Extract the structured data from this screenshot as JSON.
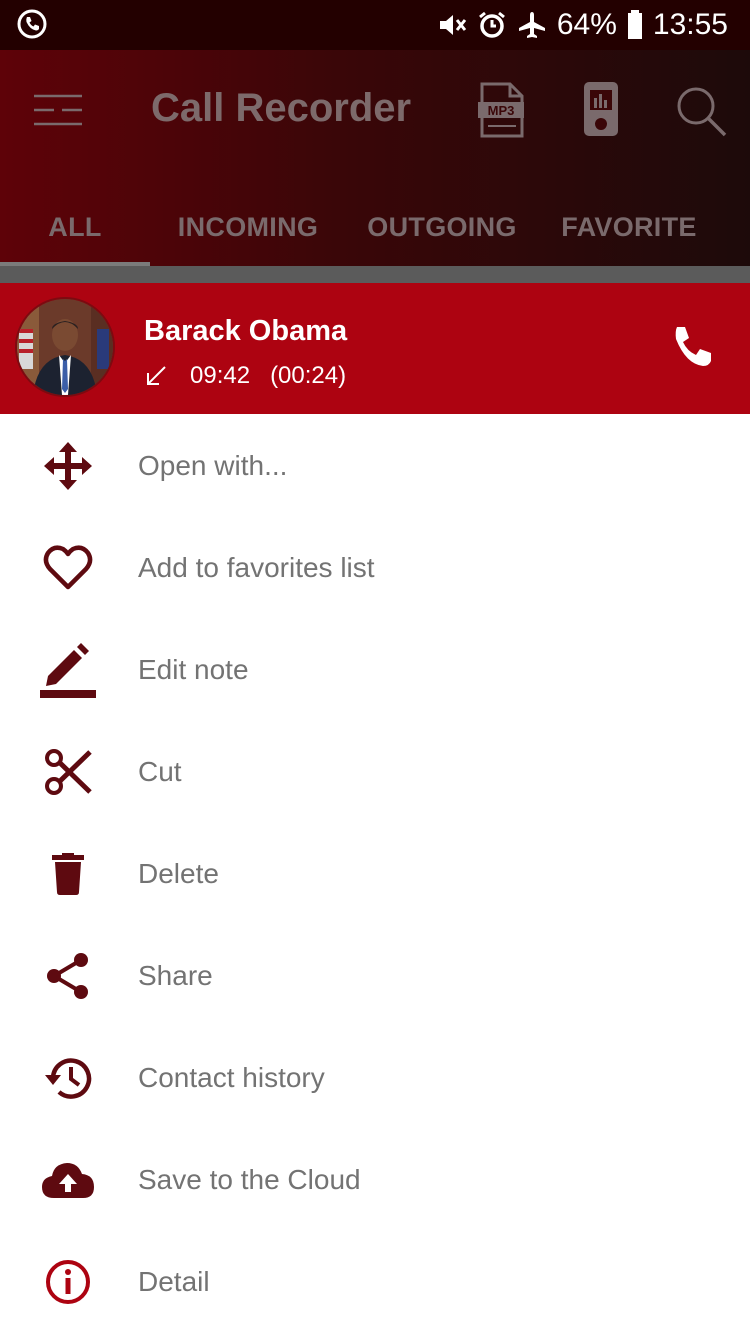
{
  "status_bar": {
    "battery": "64%",
    "time": "13:55",
    "icons": [
      "phone-icon",
      "mute-icon",
      "alarm-icon",
      "airplane-icon",
      "battery-icon"
    ]
  },
  "app_bar": {
    "title": "Call Recorder",
    "actions": [
      "menu-icon",
      "mp3-icon",
      "recorder-device-icon",
      "search-icon"
    ]
  },
  "tabs": [
    {
      "label": "ALL",
      "selected": true
    },
    {
      "label": "INCOMING",
      "selected": false
    },
    {
      "label": "OUTGOING",
      "selected": false
    },
    {
      "label": "FAVORITE",
      "selected": false
    }
  ],
  "contact": {
    "name": "Barack Obama",
    "time": "09:42",
    "duration": "(00:24)",
    "direction_icon": "incoming-arrow-icon"
  },
  "menu": [
    {
      "label": "Open with...",
      "icon": "open-with-icon"
    },
    {
      "label": "Add to favorites list",
      "icon": "heart-icon"
    },
    {
      "label": "Edit note",
      "icon": "edit-icon"
    },
    {
      "label": "Cut",
      "icon": "scissors-icon"
    },
    {
      "label": "Delete",
      "icon": "trash-icon"
    },
    {
      "label": "Share",
      "icon": "share-icon"
    },
    {
      "label": "Contact history",
      "icon": "history-icon"
    },
    {
      "label": "Save to the Cloud",
      "icon": "cloud-upload-icon"
    },
    {
      "label": "Detail",
      "icon": "info-icon"
    }
  ],
  "colors": {
    "accent": "#ad0311",
    "icon": "#5e0a10",
    "menu_text": "#737373",
    "status_bar": "#230000"
  }
}
